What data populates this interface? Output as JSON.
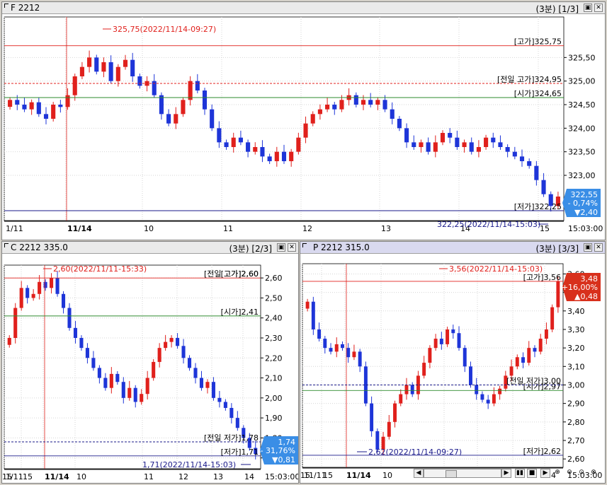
{
  "panels": {
    "f": {
      "title": "F 2212",
      "info": "(3분) [1/3]"
    },
    "c": {
      "title": "C 2212 335.0",
      "info": "(3분) [2/3]"
    },
    "p": {
      "title": "P 2212 315.0",
      "info": "(3분) [3/3]"
    }
  },
  "time_label": "15:03:00",
  "colors": {
    "up": "#e0201c",
    "down": "#1e35d8",
    "open_line": "#2e8b2e",
    "low_line": "#1a1a8a",
    "badge_down": "#3a8ee6",
    "badge_up": "#d8301c"
  },
  "icons": [
    "window-restore-icon",
    "window-close-icon",
    "scroll-left-icon",
    "scroll-right-icon",
    "stop-icon",
    "zoom-in-icon",
    "zoom-out-icon",
    "zoom-fit-icon",
    "zoom-reset-icon"
  ],
  "chart_data": [
    {
      "type": "candlestick",
      "name": "F 2212",
      "y_ticks": [
        "325,50",
        "325,00",
        "324,50",
        "324,00",
        "323,50",
        "323,00"
      ],
      "x_ticks": [
        "1/11",
        "11/14",
        "10",
        "11",
        "12",
        "13",
        "14",
        "15"
      ],
      "ylim": [
        322.1,
        326.3
      ],
      "annotations": {
        "high_marker": "325,75(2022/11/14-09:27)",
        "low_marker": "322,25(2022/11/14-15:03)",
        "high": "[고가]325,75",
        "prev_high": "[전일 고가]324,95",
        "open": "[시가]324,65",
        "low": "[저가]322,25"
      },
      "badge": {
        "price": "322,55",
        "change_pct": "- 0,74%",
        "change": "▼2,40"
      },
      "levels": {
        "high": 325.75,
        "prev_high": 324.95,
        "open": 324.65,
        "low": 322.25
      },
      "close_path": [
        324.6,
        324.5,
        324.4,
        324.55,
        324.3,
        324.2,
        324.5,
        324.45,
        324.7,
        325.1,
        325.3,
        325.5,
        325.2,
        325.4,
        325.0,
        325.3,
        325.45,
        325.1,
        324.9,
        325.0,
        324.7,
        324.3,
        324.1,
        324.3,
        324.6,
        325.0,
        324.8,
        324.4,
        324.0,
        323.7,
        323.6,
        323.8,
        323.7,
        323.5,
        323.6,
        323.4,
        323.3,
        323.5,
        323.3,
        323.5,
        323.8,
        324.1,
        324.3,
        324.4,
        324.5,
        324.4,
        324.6,
        324.7,
        324.5,
        324.6,
        324.5,
        324.6,
        324.4,
        324.2,
        324.0,
        323.7,
        323.6,
        323.7,
        323.5,
        323.7,
        323.9,
        323.8,
        323.6,
        323.7,
        323.5,
        323.6,
        323.8,
        323.7,
        323.6,
        323.5,
        323.4,
        323.3,
        323.2,
        322.9,
        322.6,
        322.35,
        322.55
      ]
    },
    {
      "type": "candlestick",
      "name": "C 2212 335.0",
      "y_ticks": [
        "2,60",
        "2,50",
        "2,40",
        "2,30",
        "2,20",
        "2,10",
        "2,00",
        "1,90",
        "1,80",
        "1,70"
      ],
      "x_ticks": [
        "1/11",
        "15",
        "11/14",
        "10",
        "11",
        "12",
        "13",
        "14",
        "15"
      ],
      "ylim": [
        1.66,
        2.65
      ],
      "annotations": {
        "high_marker": "2,60(2022/11/11-15:33)",
        "low_marker": "1,71(2022/11/14-15:03)",
        "high": "[고가]2,60",
        "prev_high": "[전일 고가]2,60",
        "open": "[시가]2,41",
        "prev_low": "[전일 저가]1,78",
        "low": "[저가]1,71"
      },
      "badge": {
        "price": "1,74",
        "change_pct": "- 31,76%",
        "change": "▼0,81"
      },
      "levels": {
        "high": 2.6,
        "open": 2.41,
        "prev_low": 1.78,
        "low": 1.71
      },
      "close_path": [
        2.3,
        2.45,
        2.55,
        2.5,
        2.52,
        2.58,
        2.55,
        2.6,
        2.52,
        2.45,
        2.35,
        2.3,
        2.25,
        2.2,
        2.15,
        2.1,
        2.05,
        2.12,
        2.08,
        2.0,
        2.05,
        1.98,
        2.02,
        2.1,
        2.18,
        2.25,
        2.28,
        2.3,
        2.26,
        2.2,
        2.15,
        2.1,
        2.05,
        2.08,
        2.0,
        1.98,
        1.95,
        1.9,
        1.85,
        1.8,
        1.75,
        1.72
      ]
    },
    {
      "type": "candlestick",
      "name": "P 2212 315.0",
      "y_ticks": [
        "3,60",
        "3,50",
        "3,40",
        "3,30",
        "3,20",
        "3,10",
        "3,00",
        "2,90",
        "2,80",
        "2,70",
        "2,60"
      ],
      "x_ticks": [
        "11/11",
        "15",
        "11/14",
        "10",
        "11",
        "12",
        "13",
        "14",
        "15"
      ],
      "ylim": [
        2.57,
        3.64
      ],
      "annotations": {
        "high_marker": "3,56(2022/11/14-15:03)",
        "low_marker": "2,62(2022/11/14-09:27)",
        "high": "[고가]3,56",
        "prev_low": "[전일 저가]3,00",
        "open": "[시가]2,97",
        "low": "[저가]2,62"
      },
      "badge": {
        "price": "3,48",
        "change_pct": "+16,00%",
        "change": "▲0,48"
      },
      "levels": {
        "high": 3.56,
        "prev_low": 3.0,
        "open": 2.97,
        "low": 2.62
      },
      "close_path": [
        3.45,
        3.3,
        3.25,
        3.2,
        3.18,
        3.22,
        3.2,
        3.15,
        3.18,
        3.1,
        2.9,
        2.75,
        2.65,
        2.72,
        2.8,
        2.9,
        2.95,
        3.0,
        2.95,
        3.05,
        3.12,
        3.2,
        3.25,
        3.22,
        3.3,
        3.28,
        3.2,
        3.1,
        3.0,
        2.95,
        2.92,
        2.9,
        2.95,
        2.98,
        3.05,
        3.1,
        3.15,
        3.12,
        3.2,
        3.18,
        3.25,
        3.3,
        3.42,
        3.56
      ]
    }
  ]
}
